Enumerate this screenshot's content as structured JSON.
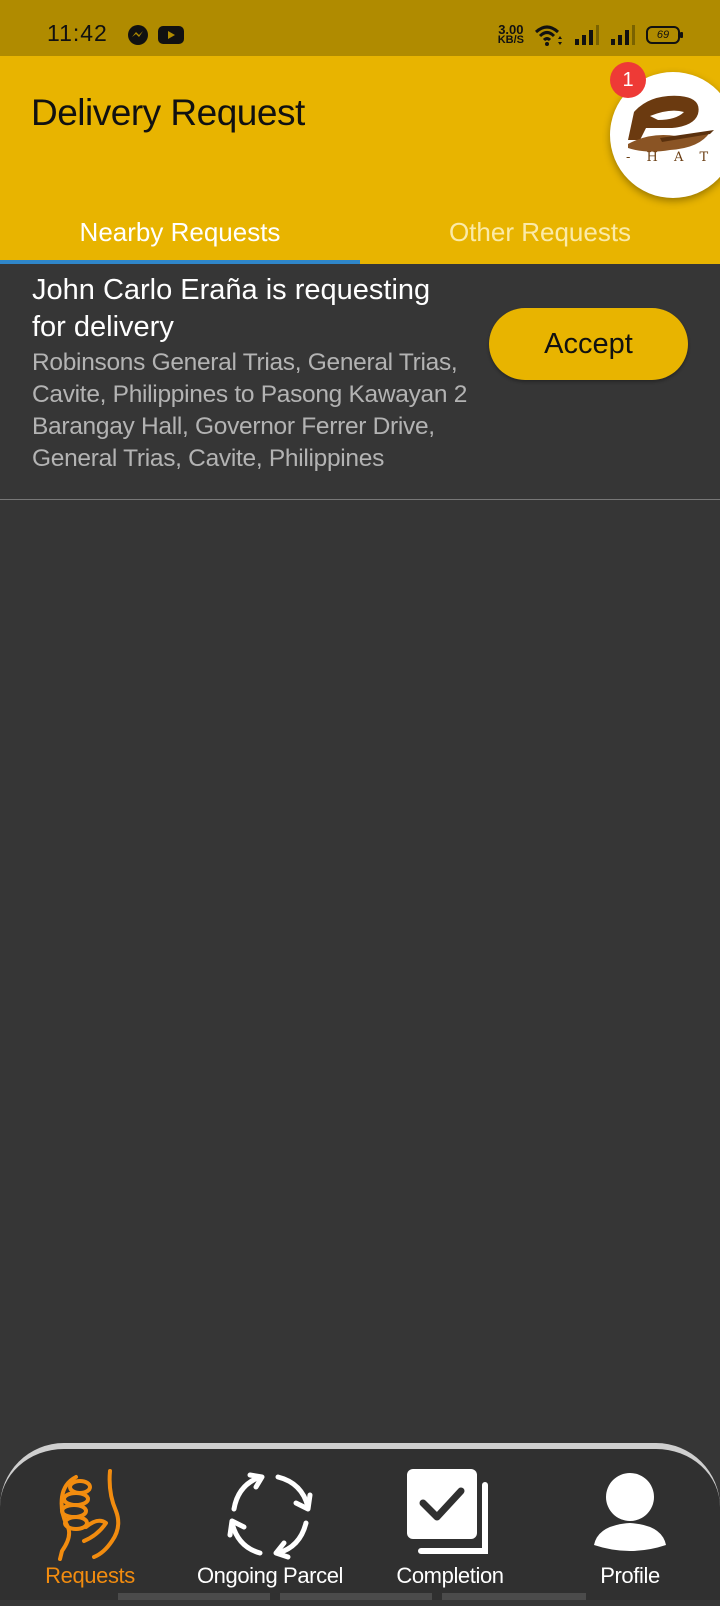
{
  "status_bar": {
    "time": "11:42",
    "net_speed_value": "3.00",
    "net_speed_unit": "KB/S",
    "battery": "69",
    "icons": [
      "messenger-icon",
      "youtube-icon",
      "wifi-icon",
      "signal-icon",
      "signal-icon",
      "battery-icon"
    ]
  },
  "header": {
    "title": "Delivery Request",
    "logo_text": "- H A T I D",
    "notification_count": "1"
  },
  "tabs": [
    {
      "label": "Nearby Requests",
      "active": true
    },
    {
      "label": "Other Requests",
      "active": false
    }
  ],
  "requests": [
    {
      "title": "John Carlo Eraña is requesting for delivery",
      "address": "Robinsons General Trias, General Trias, Cavite, Philippines to Pasong Kawayan 2 Barangay Hall, Governor Ferrer Drive, General Trias, Cavite, Philippines",
      "accept_label": "Accept"
    }
  ],
  "bottom_nav": [
    {
      "label": "Requests",
      "icon": "handshake-icon",
      "active": true
    },
    {
      "label": "Ongoing Parcel",
      "icon": "refresh-arrows-icon",
      "active": false
    },
    {
      "label": "Completion",
      "icon": "checkbox-icon",
      "active": false
    },
    {
      "label": "Profile",
      "icon": "user-icon",
      "active": false
    }
  ],
  "colors": {
    "accent": "#e8b400",
    "status_bar": "#b08b00",
    "background": "#363636",
    "tab_indicator": "#2f86c9",
    "active_nav": "#f28c0f",
    "badge": "#ee3a36"
  }
}
